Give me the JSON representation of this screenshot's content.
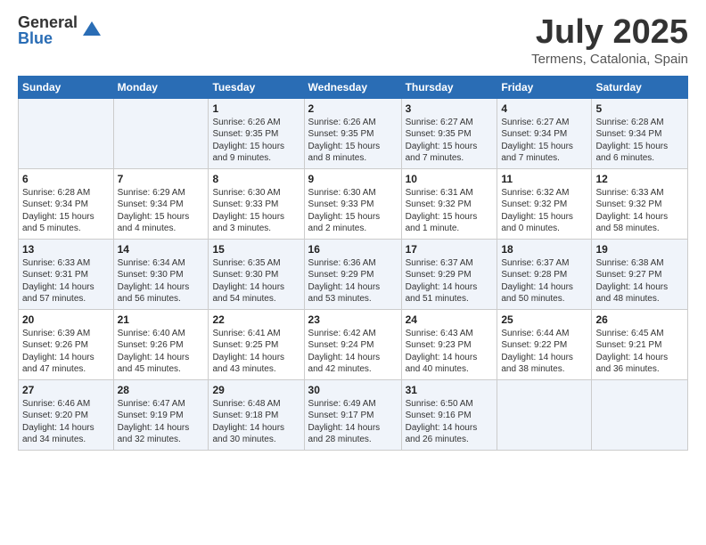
{
  "header": {
    "logo_general": "General",
    "logo_blue": "Blue",
    "month_title": "July 2025",
    "location": "Termens, Catalonia, Spain"
  },
  "weekdays": [
    "Sunday",
    "Monday",
    "Tuesday",
    "Wednesday",
    "Thursday",
    "Friday",
    "Saturday"
  ],
  "weeks": [
    [
      {
        "day": "",
        "info": ""
      },
      {
        "day": "",
        "info": ""
      },
      {
        "day": "1",
        "info": "Sunrise: 6:26 AM\nSunset: 9:35 PM\nDaylight: 15 hours and 9 minutes."
      },
      {
        "day": "2",
        "info": "Sunrise: 6:26 AM\nSunset: 9:35 PM\nDaylight: 15 hours and 8 minutes."
      },
      {
        "day": "3",
        "info": "Sunrise: 6:27 AM\nSunset: 9:35 PM\nDaylight: 15 hours and 7 minutes."
      },
      {
        "day": "4",
        "info": "Sunrise: 6:27 AM\nSunset: 9:34 PM\nDaylight: 15 hours and 7 minutes."
      },
      {
        "day": "5",
        "info": "Sunrise: 6:28 AM\nSunset: 9:34 PM\nDaylight: 15 hours and 6 minutes."
      }
    ],
    [
      {
        "day": "6",
        "info": "Sunrise: 6:28 AM\nSunset: 9:34 PM\nDaylight: 15 hours and 5 minutes."
      },
      {
        "day": "7",
        "info": "Sunrise: 6:29 AM\nSunset: 9:34 PM\nDaylight: 15 hours and 4 minutes."
      },
      {
        "day": "8",
        "info": "Sunrise: 6:30 AM\nSunset: 9:33 PM\nDaylight: 15 hours and 3 minutes."
      },
      {
        "day": "9",
        "info": "Sunrise: 6:30 AM\nSunset: 9:33 PM\nDaylight: 15 hours and 2 minutes."
      },
      {
        "day": "10",
        "info": "Sunrise: 6:31 AM\nSunset: 9:32 PM\nDaylight: 15 hours and 1 minute."
      },
      {
        "day": "11",
        "info": "Sunrise: 6:32 AM\nSunset: 9:32 PM\nDaylight: 15 hours and 0 minutes."
      },
      {
        "day": "12",
        "info": "Sunrise: 6:33 AM\nSunset: 9:32 PM\nDaylight: 14 hours and 58 minutes."
      }
    ],
    [
      {
        "day": "13",
        "info": "Sunrise: 6:33 AM\nSunset: 9:31 PM\nDaylight: 14 hours and 57 minutes."
      },
      {
        "day": "14",
        "info": "Sunrise: 6:34 AM\nSunset: 9:30 PM\nDaylight: 14 hours and 56 minutes."
      },
      {
        "day": "15",
        "info": "Sunrise: 6:35 AM\nSunset: 9:30 PM\nDaylight: 14 hours and 54 minutes."
      },
      {
        "day": "16",
        "info": "Sunrise: 6:36 AM\nSunset: 9:29 PM\nDaylight: 14 hours and 53 minutes."
      },
      {
        "day": "17",
        "info": "Sunrise: 6:37 AM\nSunset: 9:29 PM\nDaylight: 14 hours and 51 minutes."
      },
      {
        "day": "18",
        "info": "Sunrise: 6:37 AM\nSunset: 9:28 PM\nDaylight: 14 hours and 50 minutes."
      },
      {
        "day": "19",
        "info": "Sunrise: 6:38 AM\nSunset: 9:27 PM\nDaylight: 14 hours and 48 minutes."
      }
    ],
    [
      {
        "day": "20",
        "info": "Sunrise: 6:39 AM\nSunset: 9:26 PM\nDaylight: 14 hours and 47 minutes."
      },
      {
        "day": "21",
        "info": "Sunrise: 6:40 AM\nSunset: 9:26 PM\nDaylight: 14 hours and 45 minutes."
      },
      {
        "day": "22",
        "info": "Sunrise: 6:41 AM\nSunset: 9:25 PM\nDaylight: 14 hours and 43 minutes."
      },
      {
        "day": "23",
        "info": "Sunrise: 6:42 AM\nSunset: 9:24 PM\nDaylight: 14 hours and 42 minutes."
      },
      {
        "day": "24",
        "info": "Sunrise: 6:43 AM\nSunset: 9:23 PM\nDaylight: 14 hours and 40 minutes."
      },
      {
        "day": "25",
        "info": "Sunrise: 6:44 AM\nSunset: 9:22 PM\nDaylight: 14 hours and 38 minutes."
      },
      {
        "day": "26",
        "info": "Sunrise: 6:45 AM\nSunset: 9:21 PM\nDaylight: 14 hours and 36 minutes."
      }
    ],
    [
      {
        "day": "27",
        "info": "Sunrise: 6:46 AM\nSunset: 9:20 PM\nDaylight: 14 hours and 34 minutes."
      },
      {
        "day": "28",
        "info": "Sunrise: 6:47 AM\nSunset: 9:19 PM\nDaylight: 14 hours and 32 minutes."
      },
      {
        "day": "29",
        "info": "Sunrise: 6:48 AM\nSunset: 9:18 PM\nDaylight: 14 hours and 30 minutes."
      },
      {
        "day": "30",
        "info": "Sunrise: 6:49 AM\nSunset: 9:17 PM\nDaylight: 14 hours and 28 minutes."
      },
      {
        "day": "31",
        "info": "Sunrise: 6:50 AM\nSunset: 9:16 PM\nDaylight: 14 hours and 26 minutes."
      },
      {
        "day": "",
        "info": ""
      },
      {
        "day": "",
        "info": ""
      }
    ]
  ]
}
